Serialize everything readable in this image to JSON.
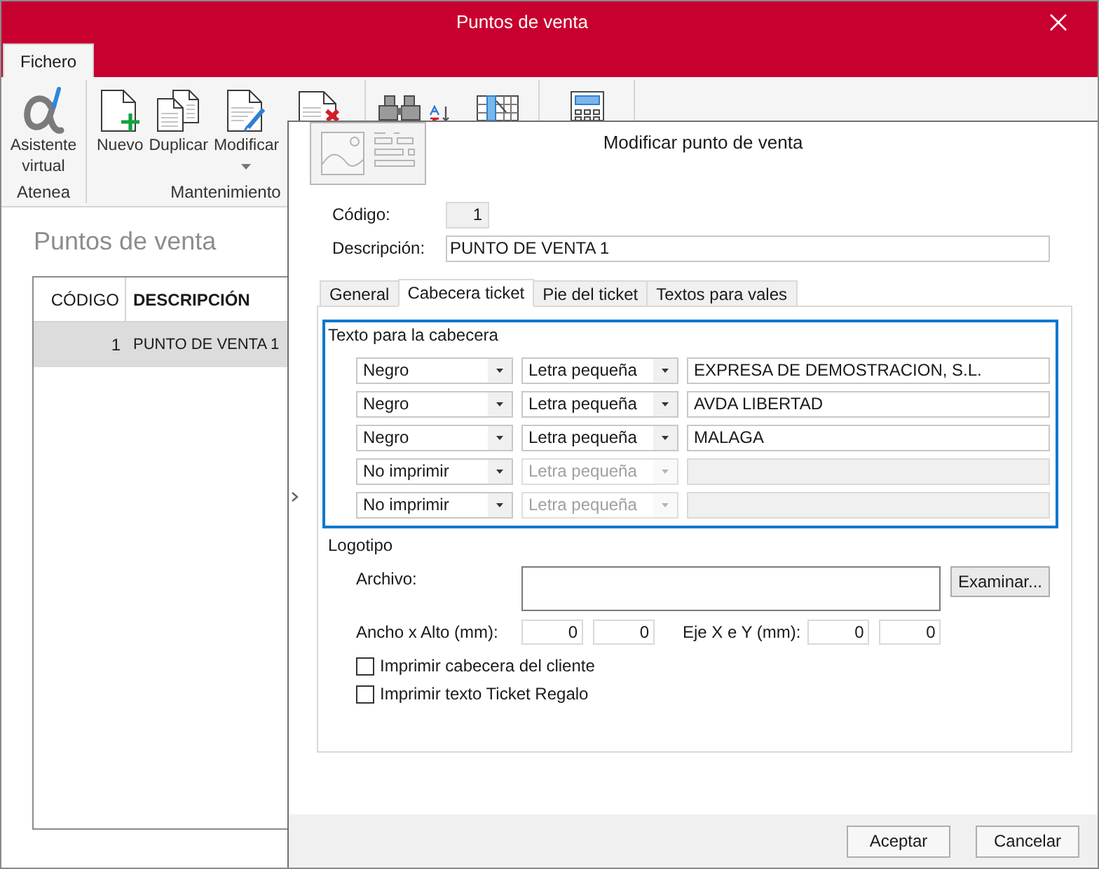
{
  "window": {
    "title": "Puntos de venta"
  },
  "ribbon": {
    "tabs": [
      {
        "label": "Fichero",
        "selected": true
      }
    ],
    "groups": [
      {
        "label": "Atenea",
        "buttons": [
          {
            "kind": "assistant",
            "label": "Asistente virtual"
          }
        ]
      },
      {
        "label": "Mantenimiento",
        "buttons": [
          {
            "kind": "new",
            "label": "Nuevo"
          },
          {
            "kind": "duplicate",
            "label": "Duplicar"
          },
          {
            "kind": "edit",
            "label": "Modificar",
            "dropdown": true
          },
          {
            "kind": "delete"
          }
        ]
      },
      {
        "buttons": [
          {
            "kind": "search"
          },
          {
            "kind": "sort"
          },
          {
            "kind": "columns"
          }
        ]
      },
      {
        "buttons": [
          {
            "kind": "calculator"
          }
        ]
      }
    ]
  },
  "list": {
    "heading": "Puntos de venta",
    "columns": [
      {
        "label": "CÓDIGO",
        "sorted": false
      },
      {
        "label": "DESCRIPCIÓN",
        "sorted": true
      }
    ],
    "rows": [
      {
        "cells": [
          "1",
          "PUNTO DE VENTA 1"
        ],
        "selected": true
      }
    ]
  },
  "dialog": {
    "title": "Modificar punto de venta",
    "fields": [
      {
        "label": "Código:",
        "value": "1",
        "readonly": true
      },
      {
        "label": "Descripción:",
        "value": "PUNTO DE VENTA 1",
        "readonly": false
      }
    ],
    "tabs": [
      {
        "label": "General",
        "selected": false
      },
      {
        "label": "Cabecera ticket",
        "selected": true
      },
      {
        "label": "Pie del ticket",
        "selected": false
      },
      {
        "label": "Textos para vales",
        "selected": false
      }
    ],
    "header_text": {
      "title": "Texto para la cabecera",
      "focused": true,
      "lines": [
        {
          "ink": "Negro",
          "size": "Letra pequeña",
          "text": "EXPRESA DE DEMOSTRACION, S.L.",
          "disabled": false
        },
        {
          "ink": "Negro",
          "size": "Letra pequeña",
          "text": "AVDA LIBERTAD",
          "disabled": false
        },
        {
          "ink": "Negro",
          "size": "Letra pequeña",
          "text": "MALAGA",
          "disabled": false
        },
        {
          "ink": "No imprimir",
          "size": "Letra pequeña",
          "disabled": true
        },
        {
          "ink": "No imprimir",
          "size": "Letra pequeña",
          "disabled": true
        }
      ]
    },
    "logo": {
      "title": "Logotipo",
      "file": {
        "label": "Archivo:",
        "button": "Examinar..."
      },
      "size": {
        "label": "Ancho x Alto (mm):",
        "values": [
          "0",
          "0"
        ]
      },
      "offset": {
        "label": "Eje X e Y (mm):",
        "values": [
          "0",
          "0"
        ]
      }
    },
    "options": [
      {
        "label": "Imprimir cabecera del cliente",
        "checked": false
      },
      {
        "label": "Imprimir texto Ticket Regalo",
        "checked": false
      }
    ],
    "buttons": [
      {
        "label": "Aceptar"
      },
      {
        "label": "Cancelar"
      }
    ]
  }
}
